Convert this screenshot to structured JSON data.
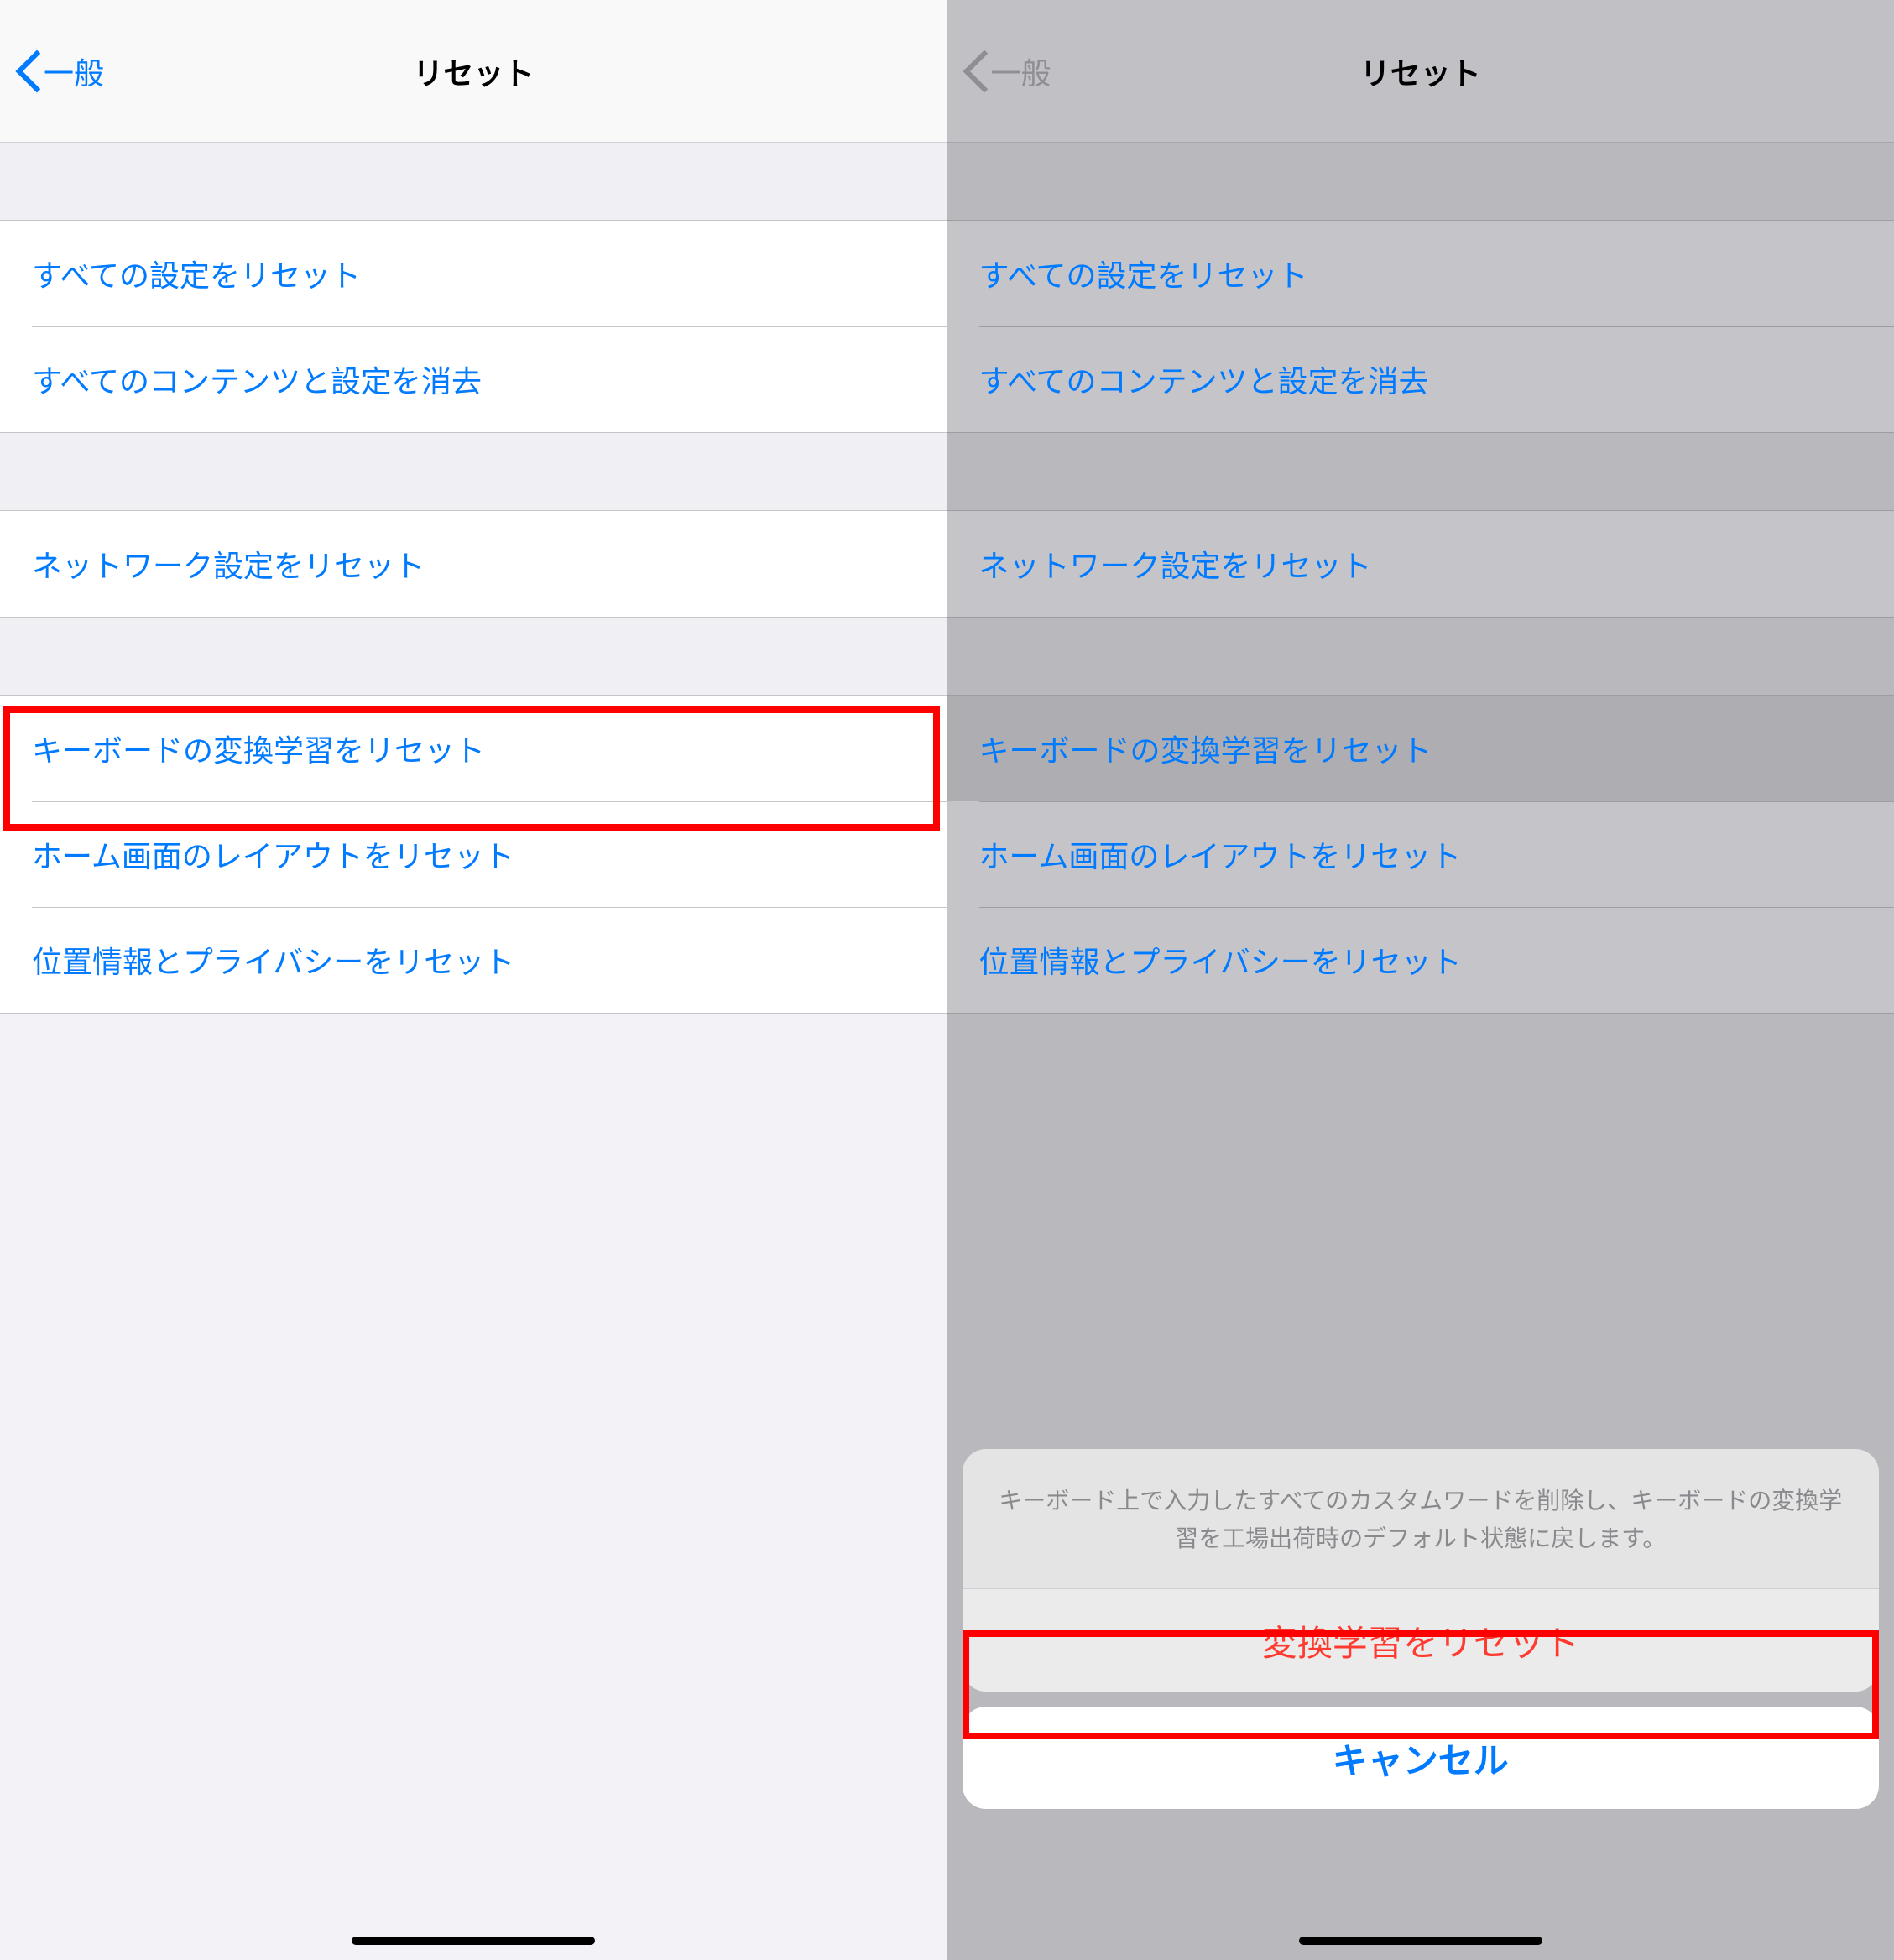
{
  "left": {
    "nav": {
      "back": "一般",
      "title": "リセット"
    },
    "group1": [
      "すべての設定をリセット",
      "すべてのコンテンツと設定を消去"
    ],
    "group2": [
      "ネットワーク設定をリセット"
    ],
    "group3": [
      "キーボードの変換学習をリセット",
      "ホーム画面のレイアウトをリセット",
      "位置情報とプライバシーをリセット"
    ]
  },
  "right": {
    "nav": {
      "back": "一般",
      "title": "リセット"
    },
    "group1": [
      "すべての設定をリセット",
      "すべてのコンテンツと設定を消去"
    ],
    "group2": [
      "ネットワーク設定をリセット"
    ],
    "group3": [
      "キーボードの変換学習をリセット",
      "ホーム画面のレイアウトをリセット",
      "位置情報とプライバシーをリセット"
    ],
    "sheet": {
      "message": "キーボード上で入力したすべてのカスタムワードを削除し、キーボードの変換学習を工場出荷時のデフォルト状態に戻します。",
      "action": "変換学習をリセット",
      "cancel": "キャンセル"
    }
  }
}
